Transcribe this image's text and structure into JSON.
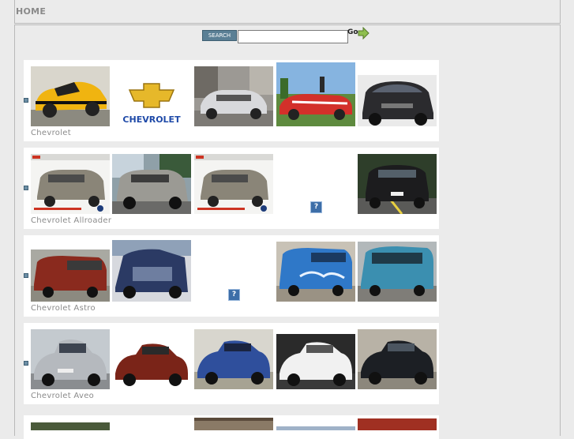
{
  "nav": {
    "home_label": "HOME"
  },
  "search": {
    "label": "SEARCH",
    "value": "",
    "go_label": "Go"
  },
  "missing_image_glyph": "?",
  "colors": {
    "accent": "#5a7f95",
    "background": "#ebebeb",
    "caption": "#8a8a8a"
  },
  "sections": [
    {
      "title": "Chevrolet"
    },
    {
      "title": "Chevrolet Allroader"
    },
    {
      "title": "Chevrolet Astro"
    },
    {
      "title": "Chevrolet Aveo"
    }
  ]
}
